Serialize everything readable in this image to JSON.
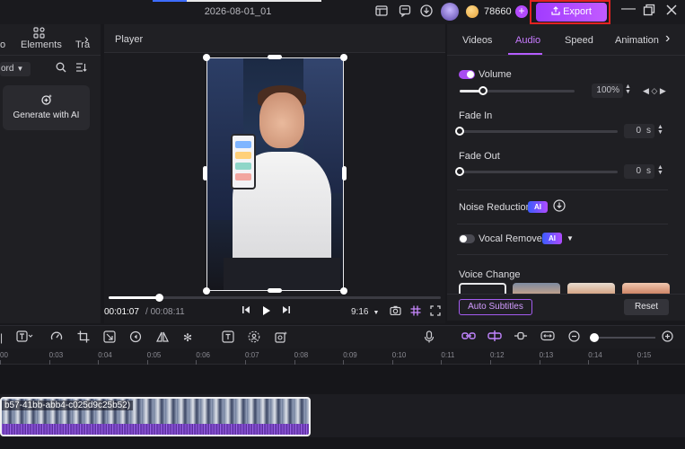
{
  "titlebar": {
    "project_title": "2026-08-01_01",
    "coins": "78660",
    "export_label": "Export",
    "icons": [
      "layout-icon",
      "feedback-icon",
      "download-icon",
      "avatar",
      "coin-icon",
      "add-coins-icon"
    ],
    "window_controls": [
      "minimize-icon",
      "restore-icon",
      "close-icon"
    ]
  },
  "left_panel": {
    "tabs": [
      {
        "label": "o"
      },
      {
        "label": "Elements"
      },
      {
        "label": "Tra"
      }
    ],
    "filter_label": "ord",
    "generate_label": "Generate with AI"
  },
  "player": {
    "title": "Player",
    "current_time": "00:01:07",
    "total_time": "00:08:11",
    "ratio": "9:16",
    "progress": 0.15
  },
  "properties": {
    "tabs": [
      {
        "label": "Videos"
      },
      {
        "label": "Audio"
      },
      {
        "label": "Speed"
      },
      {
        "label": "Animation"
      }
    ],
    "active_tab": "Audio",
    "volume": {
      "label": "Volume",
      "value": "100%",
      "enabled": true,
      "level": 0.2
    },
    "fade_in": {
      "label": "Fade In",
      "value": "0",
      "unit": "s",
      "level": 0
    },
    "fade_out": {
      "label": "Fade Out",
      "value": "0",
      "unit": "s",
      "level": 0
    },
    "noise_reduction": {
      "label": "Noise Reduction",
      "badge": "AI"
    },
    "vocal_remover": {
      "label": "Vocal Remover",
      "badge": "AI",
      "enabled": false
    },
    "voice_change": {
      "label": "Voice Change"
    },
    "auto_subtitles_label": "Auto Subtitles",
    "reset_label": "Reset"
  },
  "toolbar": {
    "zoom_level": 0.05
  },
  "ruler": {
    "ticks": [
      "00",
      "0:03",
      "0:04",
      "0:05",
      "0:06",
      "0:07",
      "0:08",
      "0:09",
      "0:10",
      "0:11",
      "0:12",
      "0:13",
      "0:14",
      "0:15"
    ]
  },
  "timeline": {
    "clip_name": "b57-41bb-abb4-c025d9c25b52)"
  },
  "colors": {
    "accent": "#b45cff",
    "export_frame": "#e32222",
    "background": "#18181c"
  }
}
